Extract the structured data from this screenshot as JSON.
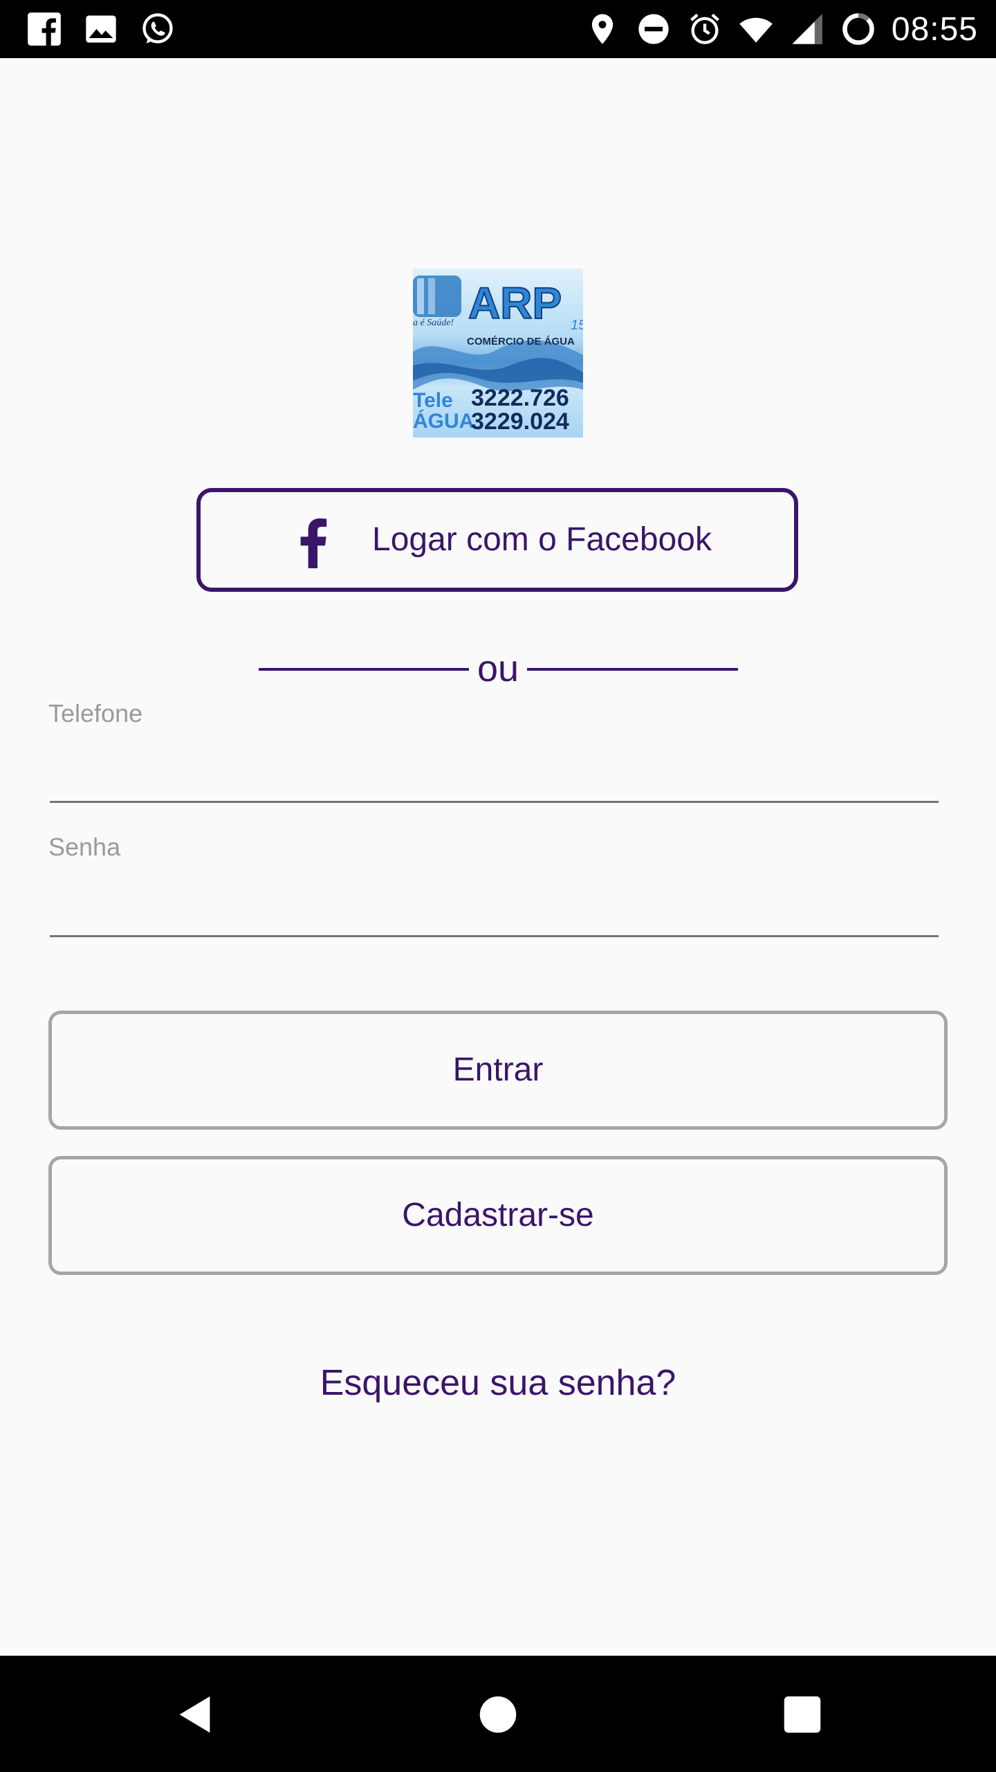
{
  "status_bar": {
    "time": "08:55",
    "left_icons": [
      "facebook-icon",
      "gallery-icon",
      "whatsapp-icon"
    ],
    "right_icons": [
      "location-icon",
      "do-not-disturb-icon",
      "alarm-icon",
      "wifi-icon",
      "signal-icon",
      "battery-icon"
    ]
  },
  "logo": {
    "brand": "ARP",
    "brand_suffix": "15",
    "tagline": "COMÉRCIO DE ÁGUA",
    "slogan": "a é Saúde!",
    "side_text_1": "Tele",
    "side_text_2": "ÁGUA",
    "phone_1": "3222.726",
    "phone_2": "3229.024"
  },
  "facebook_button": {
    "label": "Logar com o Facebook"
  },
  "divider": {
    "text": "ou"
  },
  "form": {
    "phone_label": "Telefone",
    "phone_value": "",
    "password_label": "Senha",
    "password_value": ""
  },
  "buttons": {
    "login_label": "Entrar",
    "register_label": "Cadastrar-se"
  },
  "forgot_password": {
    "label": "Esqueceu sua senha?"
  },
  "colors": {
    "accent": "#3a1569",
    "background": "#fafafa",
    "button_border": "#a6a6a6",
    "label_gray": "#9a9a9a"
  }
}
